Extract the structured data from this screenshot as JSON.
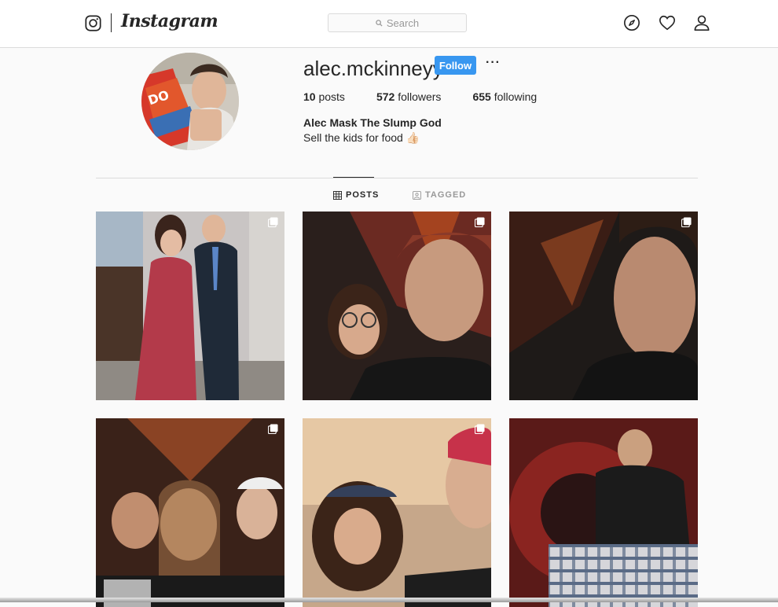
{
  "header": {
    "wordmark": "Instagram",
    "search_placeholder": "Search",
    "icons": [
      "instagram-glyph-icon",
      "explore-compass-icon",
      "activity-heart-icon",
      "profile-person-icon"
    ]
  },
  "profile": {
    "username": "alec.mckinneyy",
    "follow_label": "Follow",
    "more_label": "···",
    "posts_count": "10",
    "posts_label": "posts",
    "followers_count": "572",
    "followers_label": "followers",
    "following_count": "655",
    "following_label": "following",
    "full_name": "Alec Mask The Slump God",
    "bio": "Sell the kids for food 👍🏻"
  },
  "tabs": [
    {
      "label": "POSTS",
      "icon": "grid-icon",
      "active": true
    },
    {
      "label": "TAGGED",
      "icon": "tagged-icon",
      "active": false
    }
  ],
  "posts": [
    {
      "kind": "carousel",
      "description": "Prom couple photo"
    },
    {
      "kind": "carousel",
      "description": "Selfie with friend"
    },
    {
      "kind": "carousel",
      "description": "Close-up selfie"
    },
    {
      "kind": "carousel",
      "description": "Group of three"
    },
    {
      "kind": "carousel",
      "description": "Beach selfie"
    },
    {
      "kind": "single",
      "description": "Seated portrait"
    }
  ],
  "colors": {
    "accent": "#3897f0",
    "border": "#dbdbdb",
    "text": "#262626",
    "muted": "#999999",
    "background": "#fafafa"
  }
}
